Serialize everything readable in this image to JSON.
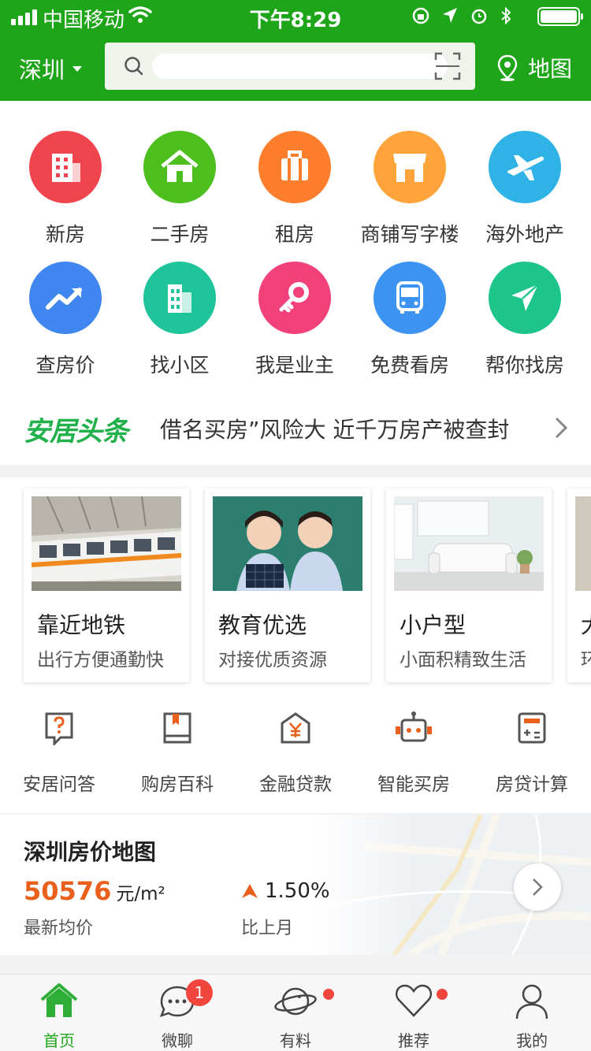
{
  "status_bar": {
    "carrier": "中国移动",
    "time": "下午8:29"
  },
  "header": {
    "city": "深圳",
    "search_value": "",
    "map_label": "地图"
  },
  "categories": [
    {
      "label": "新房",
      "icon": "building-icon",
      "color": "#f0454e"
    },
    {
      "label": "二手房",
      "icon": "house-icon",
      "color": "#4cbf1e"
    },
    {
      "label": "租房",
      "icon": "suitcase-icon",
      "color": "#ff7e2d"
    },
    {
      "label": "商铺写字楼",
      "icon": "shop-icon",
      "color": "#ffa43a"
    },
    {
      "label": "海外地产",
      "icon": "plane-icon",
      "color": "#2fb3e6"
    },
    {
      "label": "查房价",
      "icon": "trend-icon",
      "color": "#3f86f0"
    },
    {
      "label": "找小区",
      "icon": "community-icon",
      "color": "#20c49a"
    },
    {
      "label": "我是业主",
      "icon": "key-icon",
      "color": "#f2417a"
    },
    {
      "label": "免费看房",
      "icon": "bus-icon",
      "color": "#3c93f2"
    },
    {
      "label": "帮你找房",
      "icon": "send-icon",
      "color": "#1dc58a"
    }
  ],
  "news": {
    "brand": "安居头条",
    "headline": "借名买房”风险大 近千万房产被查封"
  },
  "features": [
    {
      "title": "靠近地铁",
      "subtitle": "出行方便通勤快"
    },
    {
      "title": "教育优选",
      "subtitle": "对接优质资源"
    },
    {
      "title": "小户型",
      "subtitle": "小面积精致生活"
    },
    {
      "title": "大",
      "subtitle": "环"
    }
  ],
  "tools": [
    {
      "label": "安居问答",
      "icon": "question-icon"
    },
    {
      "label": "购房百科",
      "icon": "book-icon"
    },
    {
      "label": "金融贷款",
      "icon": "finance-icon"
    },
    {
      "label": "智能买房",
      "icon": "robot-icon"
    },
    {
      "label": "房贷计算",
      "icon": "calculator-icon"
    }
  ],
  "price_map": {
    "title": "深圳房价地图",
    "avg_price": "50576",
    "unit": "元/m²",
    "avg_label": "最新均价",
    "change": "1.50%",
    "change_label": "比上月"
  },
  "tabbar": [
    {
      "label": "首页",
      "icon": "home-icon",
      "active": true
    },
    {
      "label": "微聊",
      "icon": "chat-icon",
      "badge": "1"
    },
    {
      "label": "有料",
      "icon": "planet-icon",
      "dot": true
    },
    {
      "label": "推荐",
      "icon": "heart-icon",
      "dot": true
    },
    {
      "label": "我的",
      "icon": "user-icon"
    }
  ]
}
